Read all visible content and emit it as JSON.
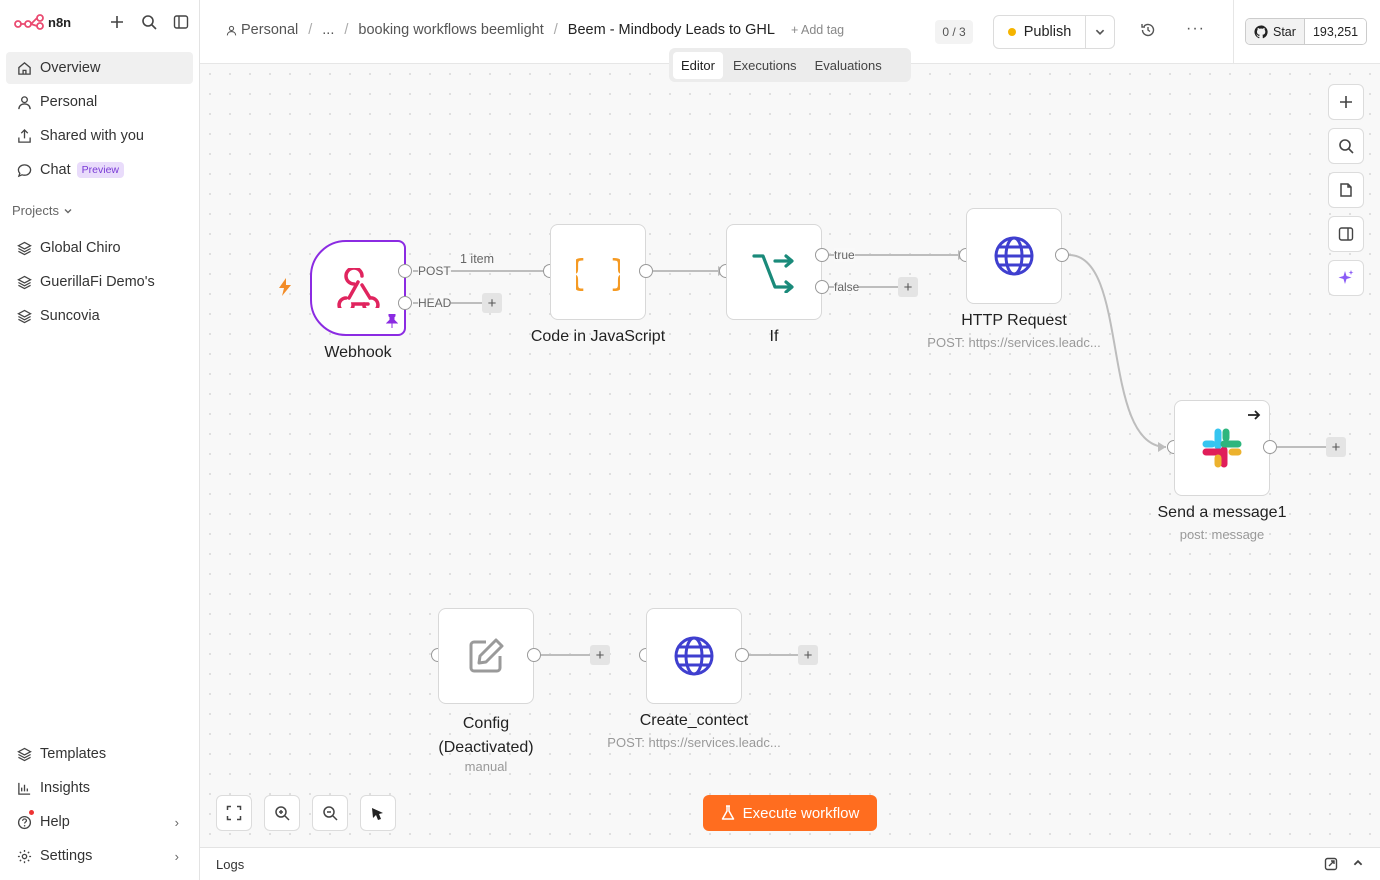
{
  "sidebar": {
    "brand": "n8n",
    "nav": [
      {
        "label": "Overview",
        "icon": "home-icon",
        "active": true
      },
      {
        "label": "Personal",
        "icon": "user-icon"
      },
      {
        "label": "Shared with you",
        "icon": "share-icon"
      },
      {
        "label": "Chat",
        "icon": "chat-icon",
        "badge": "Preview"
      }
    ],
    "projects_label": "Projects",
    "projects": [
      "Global Chiro",
      "GuerillaFi Demo's",
      "Suncovia"
    ],
    "bottom": [
      {
        "label": "Templates",
        "icon": "templates-icon"
      },
      {
        "label": "Insights",
        "icon": "chart-icon"
      },
      {
        "label": "Help",
        "icon": "help-icon"
      },
      {
        "label": "Settings",
        "icon": "gear-icon"
      }
    ]
  },
  "header": {
    "breadcrumb": [
      "Personal",
      "...",
      "booking workflows beemlight",
      "Beem - Mindbody Leads to GHL"
    ],
    "add_tag": "+ Add tag",
    "counter": "0 / 3",
    "publish": "Publish",
    "github_star": "Star",
    "github_count": "193,251",
    "tabs": [
      "Editor",
      "Executions",
      "Evaluations"
    ]
  },
  "nodes": {
    "webhook": {
      "label": "Webhook",
      "out1": "POST",
      "out2": "HEAD",
      "edge_label": "1 item"
    },
    "code": {
      "label": "Code in JavaScript"
    },
    "if": {
      "label": "If",
      "true_label": "true",
      "false_label": "false"
    },
    "http": {
      "label": "HTTP Request",
      "sub": "POST: https://services.leadc..."
    },
    "slack": {
      "label": "Send a message1",
      "sub": "post: message"
    },
    "config": {
      "label": "Config\n(Deactivated)",
      "sub": "manual"
    },
    "create": {
      "label": "Create_contect",
      "sub": "POST: https://services.leadc..."
    }
  },
  "canvas": {
    "execute": "Execute workflow",
    "logs": "Logs"
  },
  "colors": {
    "accent": "#ff6d1f",
    "trigger_border": "#8b2be2",
    "webhook_icon": "#e0245e",
    "code_icon": "#f59a23",
    "if_icon": "#1a8a7a",
    "http_icon": "#3f3fcf"
  }
}
